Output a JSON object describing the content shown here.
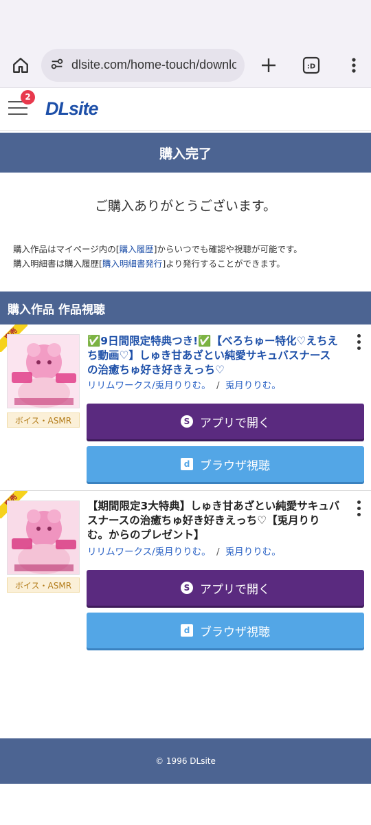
{
  "browser": {
    "url": "dlsite.com/home-touch/downloa",
    "tab_icon_text": ":D"
  },
  "header": {
    "logo": "DLsite",
    "menu_badge": "2"
  },
  "page": {
    "title": "購入完了",
    "thanks": "ご購入ありがとうございます。",
    "info_line1_prefix": "購入作品はマイページ内の[",
    "info_line1_link": "購入履歴",
    "info_line1_suffix": "]からいつでも確認や視聴が可能です。",
    "info_line2_prefix": "購入明細書は購入履歴[",
    "info_line2_link": "購入明細書発行",
    "info_line2_suffix": "]より発行することができます。"
  },
  "section": {
    "title": "購入作品 作品視聴"
  },
  "works": [
    {
      "ribbon": "専売",
      "genre": "ボイス・ASMR",
      "title": "✅9日間限定特典つき!✅【べろちゅー特化♡えちえち動画♡】しゅき甘あざとい純愛サキュバスナースの治癒ちゅ好き好きえっち♡",
      "circle": "リリムワークス/兎月りりむ。",
      "separator": "/",
      "author": "兎月りりむ。",
      "app_button": "アプリで開く",
      "browser_button": "ブラウザ視聴"
    },
    {
      "ribbon": "専売",
      "genre": "ボイス・ASMR",
      "title": "【期間限定3大特典】しゅき甘あざとい純愛サキュバスナースの治癒ちゅ好き好きえっち♡【兎月りりむ。からのプレゼント】",
      "circle": "リリムワークス/兎月りりむ。",
      "separator": "/",
      "author": "兎月りりむ。",
      "app_button": "アプリで開く",
      "browser_button": "ブラウザ視聴"
    }
  ],
  "footer": {
    "copyright": "© 1996 DLsite"
  },
  "colors": {
    "header_bar": "#4c6492",
    "app_button": "#5a2a7f",
    "browser_button": "#53a6e6",
    "link": "#1d4fa8"
  }
}
